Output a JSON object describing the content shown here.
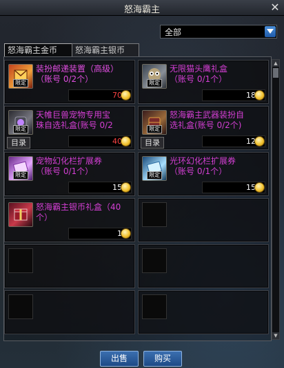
{
  "window": {
    "title": "怒海霸主",
    "close_label": "✕"
  },
  "filter": {
    "selected": "全部"
  },
  "tabs": [
    {
      "label": "怒海霸主金币",
      "active": true
    },
    {
      "label": "怒海霸主银币",
      "active": false
    }
  ],
  "items": [
    {
      "name1": "装扮邮递装置（高级）",
      "name2": "（账号 0/2个）",
      "price": "70",
      "tag": "限定",
      "name_color": "#e04ee0",
      "price_color": "#ff4444",
      "icon": "mail-box-icon",
      "has_catalog": false
    },
    {
      "name1": "无限猫头鹰礼盒",
      "name2": "（账号 0/1个）",
      "price": "18",
      "tag": "限定",
      "name_color": "#d43fd4",
      "price_color": "#ffffff",
      "icon": "owl-box-icon",
      "has_catalog": false
    },
    {
      "name1": "天帷巨兽宠物专用宝",
      "name2": "珠自选礼盒(账号 0/2",
      "price": "40",
      "tag": "限定",
      "name_color": "#d43fd4",
      "price_color": "#ff4444",
      "icon": "orb-box-icon",
      "has_catalog": true,
      "catalog_label": "目录"
    },
    {
      "name1": "怒海霸主武器装扮自",
      "name2": "选礼盒(账号 0/2个)",
      "price": "12",
      "tag": "限定",
      "name_color": "#d43fd4",
      "price_color": "#ffffff",
      "icon": "weapon-box-icon",
      "has_catalog": true,
      "catalog_label": "目录"
    },
    {
      "name1": "宠物幻化栏扩展券",
      "name2": "（账号 0/1个）",
      "price": "15",
      "tag": "限定",
      "name_color": "#d43fd4",
      "price_color": "#ffffff",
      "icon": "pet-ticket-icon",
      "has_catalog": false
    },
    {
      "name1": "光环幻化栏扩展券",
      "name2": "（账号 0/1个）",
      "price": "15",
      "tag": "限定",
      "name_color": "#d43fd4",
      "price_color": "#ffffff",
      "icon": "aura-ticket-icon",
      "has_catalog": false
    },
    {
      "name1": "怒海霸主银币礼盒（40",
      "name2": "个）",
      "price": "1",
      "tag": "",
      "name_color": "#d43fd4",
      "price_color": "#ffffff",
      "icon": "silver-gift-icon",
      "has_catalog": false
    }
  ],
  "buttons": {
    "sell": "出售",
    "buy": "购买"
  },
  "colors": {
    "accent_blue": "#1e4a86",
    "coin_gold": "#f2c230"
  }
}
